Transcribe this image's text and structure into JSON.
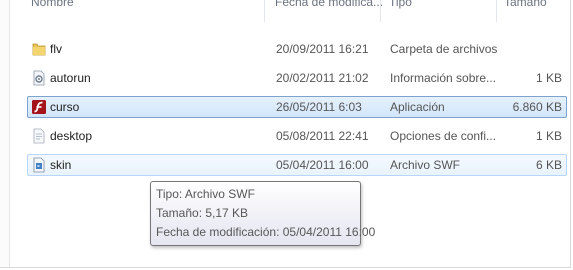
{
  "header": {
    "name": "Nombre",
    "date": "Fecha de modifica...",
    "type": "Tipo",
    "size": "Tamaño"
  },
  "files": [
    {
      "name": "flv",
      "date": "20/09/2011 16:21",
      "type": "Carpeta de archivos",
      "size": "",
      "icon": "folder-icon"
    },
    {
      "name": "autorun",
      "date": "20/02/2011 21:02",
      "type": "Información sobre...",
      "size": "1 KB",
      "icon": "settings-file-icon"
    },
    {
      "name": "curso",
      "date": "26/05/2011 6:03",
      "type": "Aplicación",
      "size": "6.860 KB",
      "icon": "flash-app-icon",
      "selected": true
    },
    {
      "name": "desktop",
      "date": "05/08/2011 22:41",
      "type": "Opciones de confi...",
      "size": "1 KB",
      "icon": "config-file-icon"
    },
    {
      "name": "skin",
      "date": "05/04/2011 16:00",
      "type": "Archivo SWF",
      "size": "6 KB",
      "icon": "swf-file-icon",
      "hover": true
    }
  ],
  "tooltip": {
    "type_line": "Tipo: Archivo SWF",
    "size_line": "Tamaño: 5,17 KB",
    "date_line": "Fecha de modificación: 05/04/2011 16:00"
  },
  "colors": {
    "selection_border": "#7da2ce",
    "selection_fill": "#d1e6fa",
    "hover_border": "#b8d6fb",
    "header_text": "#6b7380"
  }
}
